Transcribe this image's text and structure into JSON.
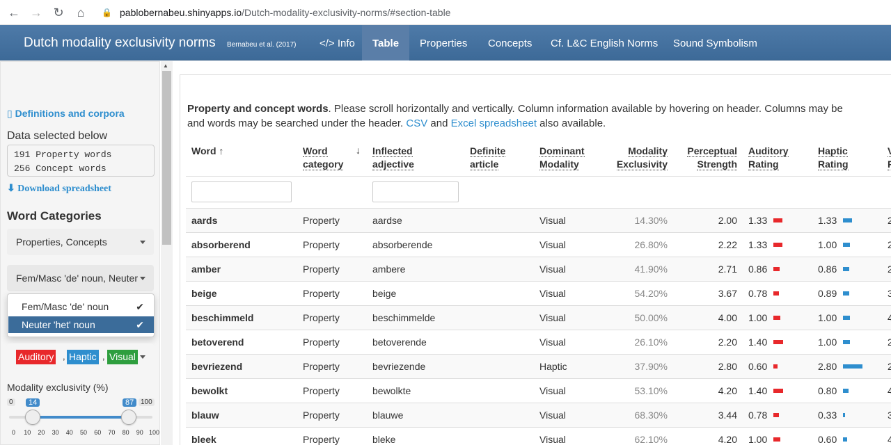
{
  "browser": {
    "url_host": "pablobernabeu.shinyapps.io",
    "url_path": "/Dutch-modality-exclusivity-norms/#section-table"
  },
  "navbar": {
    "title": "Dutch modality exclusivity norms",
    "subtitle": "Bernabeu et al. (2017)",
    "tabs": [
      {
        "label": "</> Info",
        "active": false
      },
      {
        "label": "Table",
        "active": true
      },
      {
        "label": "Properties",
        "active": false
      },
      {
        "label": "Concepts",
        "active": false
      },
      {
        "label": "Cf. L&C English Norms",
        "active": false
      },
      {
        "label": "Sound Symbolism",
        "active": false
      }
    ]
  },
  "sidebar": {
    "definitions_link": "Definitions and corpora",
    "data_selected_label": "Data selected below",
    "data_selected_lines": [
      "191 Property words",
      "256 Concept words"
    ],
    "download_link": "Download spreadsheet",
    "word_categories_heading": "Word Categories",
    "category_picker_value": "Properties, Concepts",
    "gender_picker_value": "Fem/Masc 'de' noun, Neuter",
    "gender_options": [
      {
        "label": "Fem/Masc 'de' noun",
        "selected": true
      },
      {
        "label": "Neuter 'het' noun",
        "selected": true
      }
    ],
    "modality_badges": [
      {
        "label": "Auditory",
        "color": "#e8282b"
      },
      {
        "label": "Haptic",
        "color": "#2e8ece"
      },
      {
        "label": "Visual",
        "color": "#2e9e3e"
      }
    ],
    "modality_label": "Modality exclusivity (%)",
    "slider": {
      "min": "0",
      "max": "100",
      "low": "14",
      "high": "87",
      "ticks": [
        "0",
        "10",
        "20",
        "30",
        "40",
        "50",
        "60",
        "70",
        "80",
        "90",
        "100"
      ]
    }
  },
  "table": {
    "intro_bold": "Property and concept words",
    "intro_text": ". Please scroll horizontally and vertically. Column information available by hovering on header. Columns may be",
    "intro_line2_a": "and words may be searched under the header. ",
    "intro_csv": "CSV",
    "intro_and": " and ",
    "intro_excel": "Excel spreadsheet",
    "intro_end": " also available.",
    "headers": {
      "word": "Word",
      "word_sort": "↑",
      "category_l1": "Word",
      "category_l2": "category",
      "category_sort": "↓",
      "inflected_l1": "Inflected",
      "inflected_l2": "adjective",
      "definite_l1": "Definite",
      "definite_l2": "article",
      "dominant_l1": "Dominant",
      "dominant_l2": "Modality",
      "exclusivity_l1": "Modality",
      "exclusivity_l2": "Exclusivity",
      "strength_l1": "Perceptual",
      "strength_l2": "Strength",
      "auditory_l1": "Auditory",
      "auditory_l2": "Rating",
      "haptic_l1": "Haptic",
      "haptic_l2": "Rating",
      "visual_l1": "V",
      "visual_l2": "R"
    },
    "rows": [
      {
        "word": "aards",
        "category": "Property",
        "inflected": "aardse",
        "dominant": "Visual",
        "exclusivity": "14.30%",
        "strength": "2.00",
        "auditory": "1.33",
        "haptic": "1.33",
        "visual": "2"
      },
      {
        "word": "absorberend",
        "category": "Property",
        "inflected": "absorberende",
        "dominant": "Visual",
        "exclusivity": "26.80%",
        "strength": "2.22",
        "auditory": "1.33",
        "haptic": "1.00",
        "visual": "2"
      },
      {
        "word": "amber",
        "category": "Property",
        "inflected": "ambere",
        "dominant": "Visual",
        "exclusivity": "41.90%",
        "strength": "2.71",
        "auditory": "0.86",
        "haptic": "0.86",
        "visual": "2"
      },
      {
        "word": "beige",
        "category": "Property",
        "inflected": "beige",
        "dominant": "Visual",
        "exclusivity": "54.20%",
        "strength": "3.67",
        "auditory": "0.78",
        "haptic": "0.89",
        "visual": "3"
      },
      {
        "word": "beschimmeld",
        "category": "Property",
        "inflected": "beschimmelde",
        "dominant": "Visual",
        "exclusivity": "50.00%",
        "strength": "4.00",
        "auditory": "1.00",
        "haptic": "1.00",
        "visual": "4"
      },
      {
        "word": "betoverend",
        "category": "Property",
        "inflected": "betoverende",
        "dominant": "Visual",
        "exclusivity": "26.10%",
        "strength": "2.20",
        "auditory": "1.40",
        "haptic": "1.00",
        "visual": "2"
      },
      {
        "word": "bevriezend",
        "category": "Property",
        "inflected": "bevriezende",
        "dominant": "Haptic",
        "exclusivity": "37.90%",
        "strength": "2.80",
        "auditory": "0.60",
        "haptic": "2.80",
        "visual": "2"
      },
      {
        "word": "bewolkt",
        "category": "Property",
        "inflected": "bewolkte",
        "dominant": "Visual",
        "exclusivity": "53.10%",
        "strength": "4.20",
        "auditory": "1.40",
        "haptic": "0.80",
        "visual": "4"
      },
      {
        "word": "blauw",
        "category": "Property",
        "inflected": "blauwe",
        "dominant": "Visual",
        "exclusivity": "68.30%",
        "strength": "3.44",
        "auditory": "0.78",
        "haptic": "0.33",
        "visual": "3"
      },
      {
        "word": "bleek",
        "category": "Property",
        "inflected": "bleke",
        "dominant": "Visual",
        "exclusivity": "62.10%",
        "strength": "4.20",
        "auditory": "1.00",
        "haptic": "0.60",
        "visual": "4"
      }
    ],
    "colors": {
      "auditory_bar": "#e8282b",
      "haptic_bar": "#2e8ece"
    }
  }
}
